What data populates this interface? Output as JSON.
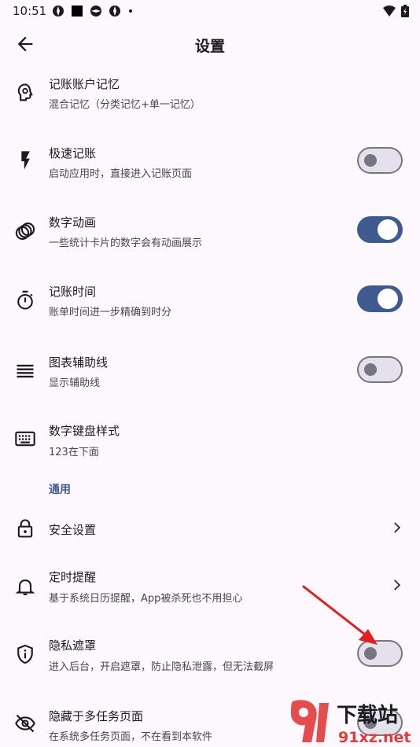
{
  "status_bar": {
    "time": "10:51"
  },
  "header": {
    "title": "设置"
  },
  "settings": [
    {
      "title": "记账账户记忆",
      "subtitle": "混合记忆（分类记忆+单一记忆）"
    },
    {
      "title": "极速记账",
      "subtitle": "启动应用时，直接进入记账页面",
      "toggle": false
    },
    {
      "title": "数字动画",
      "subtitle": "一些统计卡片的数字会有动画展示",
      "toggle": true
    },
    {
      "title": "记账时间",
      "subtitle": "账单时间进一步精确到时分",
      "toggle": true
    },
    {
      "title": "图表辅助线",
      "subtitle": "显示辅助线",
      "toggle": false
    },
    {
      "title": "数字键盘样式",
      "subtitle": "123在下面"
    }
  ],
  "general": {
    "section_title": "通用",
    "items": [
      {
        "title": "安全设置"
      },
      {
        "title": "定时提醒",
        "subtitle": "基于系统日历提醒，App被杀死也不用担心"
      },
      {
        "title": "隐私遮罩",
        "subtitle": "进入后台，开启遮罩，防止隐私泄露，但无法截屏",
        "toggle": false
      },
      {
        "title": "隐藏于多任务页面",
        "subtitle": "在系统多任务页面，不在看到本软件",
        "toggle": false
      }
    ]
  },
  "watermark": {
    "brand": "下载站",
    "site": "91xz.net"
  },
  "colors": {
    "accent": "#3f5a8e",
    "background": "#fcf8fd",
    "arrow": "#e02020"
  }
}
